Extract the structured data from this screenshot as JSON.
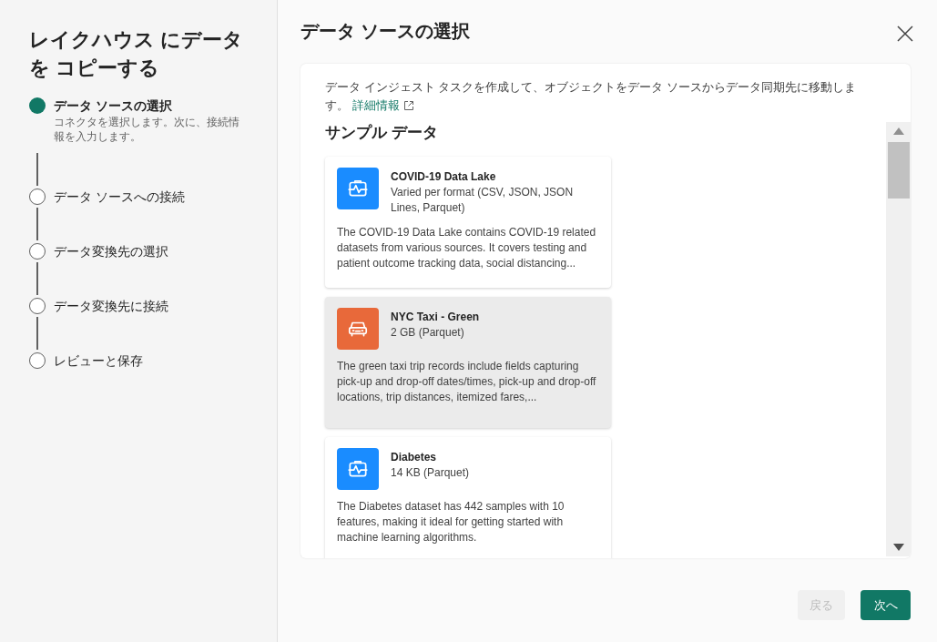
{
  "sidebar": {
    "title": "レイクハウス にデータを コピーする",
    "steps": [
      {
        "label": "データ ソースの選択",
        "selected": true,
        "description": "コネクタを選択します。次に、接続情報を入力します。"
      },
      {
        "label": "データ ソースへの接続",
        "selected": false
      },
      {
        "label": "データ変換先の選択",
        "selected": false
      },
      {
        "label": "データ変換先に接続",
        "selected": false
      },
      {
        "label": "レビューと保存",
        "selected": false
      }
    ]
  },
  "main": {
    "title": "データ ソースの選択",
    "intro": "データ インジェスト タスクを作成して、オブジェクトをデータ ソースからデータ同期先に移動します。",
    "learn_more": "詳細情報",
    "section_title": "サンプル データ",
    "datasets": [
      {
        "name": "COVID-19 Data Lake",
        "size": "Varied per format (CSV, JSON, JSON Lines, Parquet)",
        "description": "The COVID-19 Data Lake contains COVID-19 related datasets from various sources. It covers testing and patient outcome tracking data, social distancing...",
        "kind": "health",
        "color": "#1a8cff",
        "selected": false
      },
      {
        "name": "NYC Taxi - Green",
        "size": "2 GB (Parquet)",
        "description": "The green taxi trip records include fields capturing pick-up and drop-off dates/times, pick-up and drop-off locations, trip distances, itemized fares,...",
        "kind": "car",
        "color": "#e8693a",
        "selected": true
      },
      {
        "name": "Diabetes",
        "size": "14 KB (Parquet)",
        "description": "The Diabetes dataset has 442 samples with 10 features, making it ideal for getting started with machine learning algorithms.",
        "kind": "health",
        "color": "#1a8cff",
        "selected": false
      }
    ]
  },
  "footer": {
    "back": {
      "label": "戻る",
      "disabled": true
    },
    "next": {
      "label": "次へ",
      "disabled": false
    }
  }
}
